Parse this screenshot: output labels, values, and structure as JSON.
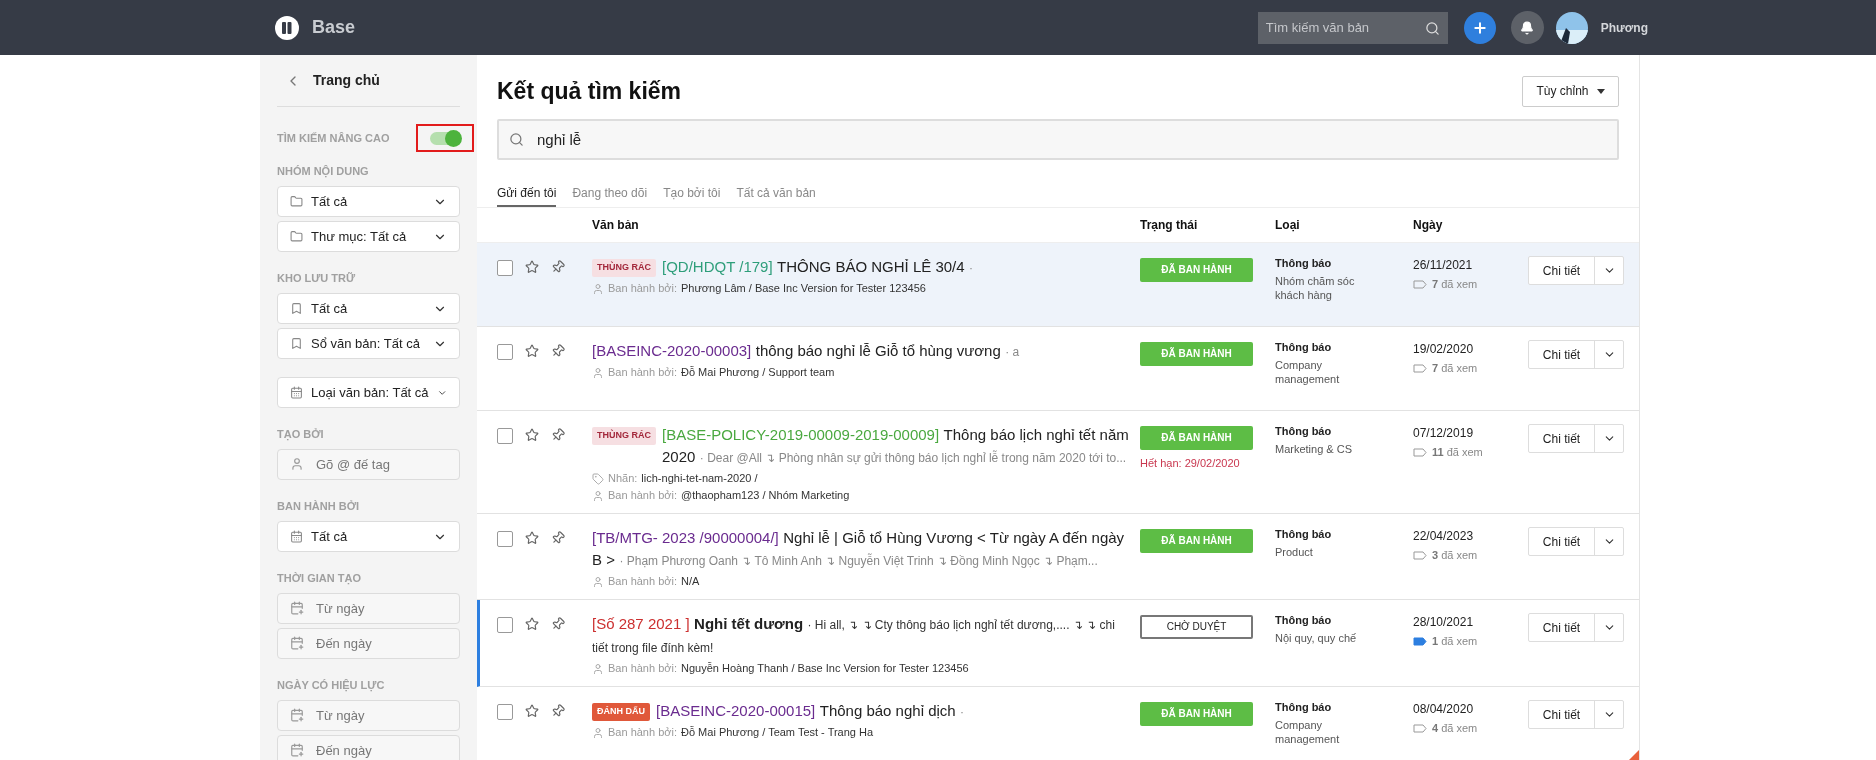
{
  "topbar": {
    "brand": "Base",
    "search": {
      "placeholder": "Tìm kiếm văn bản"
    },
    "user": "Phương"
  },
  "sidebar": {
    "back": "Trang chủ",
    "advanced": {
      "label": "TÌM KIẾM NÂNG CAO",
      "on": true
    },
    "sections": [
      {
        "label": "NHÓM NỘI DUNG",
        "fields": [
          {
            "kind": "select",
            "text": "Tất cả"
          },
          {
            "kind": "select",
            "text": "Thư mục: Tất cả"
          }
        ]
      },
      {
        "label": "KHO LƯU TRỮ",
        "fields": [
          {
            "kind": "select",
            "text": "Tất cả"
          },
          {
            "kind": "select",
            "text": "Sổ văn bản: Tất cả"
          }
        ]
      },
      {
        "fields": [
          {
            "kind": "select",
            "text": "Loại văn bản: Tất cả"
          }
        ]
      },
      {
        "label": "TẠO BỞI",
        "fields": [
          {
            "kind": "input",
            "placeholder": "Gõ @ đế tag"
          }
        ]
      },
      {
        "label": "BAN HÀNH BỞI",
        "fields": [
          {
            "kind": "select",
            "text": "Tất cả"
          }
        ]
      },
      {
        "label": "THỜI GIAN TẠO",
        "fields": [
          {
            "kind": "date",
            "placeholder": "Từ ngày"
          },
          {
            "kind": "date",
            "placeholder": "Đến ngày"
          }
        ]
      },
      {
        "label": "NGÀY CÓ HIỆU LỰC",
        "fields": [
          {
            "kind": "date",
            "placeholder": "Từ ngày"
          },
          {
            "kind": "date",
            "placeholder": "Đến ngày"
          }
        ]
      }
    ]
  },
  "main": {
    "title": "Kết quả tìm kiếm",
    "customize": "Tùy chỉnh",
    "query": "nghỉ lễ",
    "tabs": [
      {
        "label": "Gửi đến tôi",
        "selected": true
      },
      {
        "label": "Đang theo dõi",
        "selected": false
      },
      {
        "label": "Tạo bởi tôi",
        "selected": false
      },
      {
        "label": "Tất cả văn bản",
        "selected": false
      }
    ],
    "columns": [
      "Văn bản",
      "Trạng thái",
      "Loại",
      "Ngày"
    ],
    "rows": [
      {
        "selected": true,
        "unread": false,
        "tag": {
          "kind": "trash",
          "label": "THÙNG RÁC"
        },
        "code": "[QD/HDQT /179]",
        "color": "#2e9e7a",
        "title": "THÔNG BÁO NGHỈ LÊ 30/4",
        "excerpt": "·",
        "issuer_label": "Ban hành bởi:",
        "issuer": "Phương Lâm / Base Inc Version for Tester 123456",
        "status": {
          "kind": "published",
          "label": "ĐÃ BAN HÀNH"
        },
        "type": "Thông báo",
        "group": "Nhóm chăm sóc khách hàng",
        "date": "26/11/2021",
        "views": "7",
        "views_label": "đã xem",
        "action": "Chi tiết"
      },
      {
        "selected": false,
        "unread": false,
        "code": "[BASEINC-2020-00003]",
        "color": "#6a2b8f",
        "title": "thông báo nghỉ lễ Giỗ tổ hùng vương",
        "excerpt": "· a",
        "issuer_label": "Ban hành bởi:",
        "issuer": "Đỗ Mai Phương / Support team",
        "status": {
          "kind": "published",
          "label": "ĐÃ BAN HÀNH"
        },
        "type": "Thông báo",
        "group": "Company management",
        "date": "19/02/2020",
        "views": "7",
        "views_label": "đã xem",
        "action": "Chi tiết"
      },
      {
        "selected": false,
        "unread": false,
        "tag": {
          "kind": "trash",
          "label": "THÙNG RÁC"
        },
        "code": "[BASE-POLICY-2019-00009-2019-00009]",
        "color": "#4aa83f",
        "title": "Thông báo lịch nghỉ tết năm 2020",
        "excerpt": "· Dear @All ↴ Phòng nhân sự gửi thông báo lịch nghỉ lễ trong năm 2020 tới to...",
        "label_label": "Nhãn:",
        "label": "lich-nghi-tet-nam-2020 /",
        "issuer_label": "Ban hành bởi:",
        "issuer": "@thaopham123 / Nhóm Marketing",
        "status": {
          "kind": "published",
          "label": "ĐÃ BAN HÀNH"
        },
        "expiry": "Hết hạn: 29/02/2020",
        "type": "Thông báo",
        "group": "Marketing & CS",
        "date": "07/12/2019",
        "views": "11",
        "views_label": "đã xem",
        "action": "Chi tiết"
      },
      {
        "selected": false,
        "unread": false,
        "code": "[TB/MTG- 2023 /90000004/]",
        "color": "#6a2b8f",
        "title": "Nghỉ lễ | Giỗ tổ Hùng Vương < Từ ngày A đến ngày B >",
        "excerpt": "· Phạm Phương Oanh ↴ Tô Minh Anh ↴ Nguyễn Việt Trinh ↴ Đồng Minh Ngọc ↴ Phạm...",
        "issuer_label": "Ban hành bởi:",
        "issuer": "N/A",
        "status": {
          "kind": "published",
          "label": "ĐÃ BAN HÀNH"
        },
        "type": "Thông báo",
        "group": "Product",
        "date": "22/04/2023",
        "views": "3",
        "views_label": "đã xem",
        "action": "Chi tiết"
      },
      {
        "selected": false,
        "unread": true,
        "code": "[Số 287 2021 ]",
        "color": "#cc2f2f",
        "title": "Nghỉ tết dương",
        "excerpt": "· Hi all, ↴ ↴ Cty thông báo lịch nghỉ tết dương,.... ↴ ↴ chi tiết trong file đính kèm!",
        "issuer_label": "Ban hành bởi:",
        "issuer": "Nguyễn Hoàng Thanh / Base Inc Version for Tester 123456",
        "status": {
          "kind": "pending",
          "label": "CHỜ DUYỆT"
        },
        "type": "Thông báo",
        "group": "Nội quy, quy chế",
        "date": "28/10/2021",
        "views": "1",
        "views_label": "đã xem",
        "action": "Chi tiết"
      },
      {
        "selected": false,
        "unread": false,
        "tag": {
          "kind": "flag",
          "label": "ĐÁNH DẤU"
        },
        "code": "[BASEINC-2020-00015]",
        "color": "#6a2b8f",
        "title": "Thông báo nghỉ dịch",
        "excerpt": "·",
        "issuer_label": "Ban hành bởi:",
        "issuer": "Đỗ Mai Phương / Team Test - Trang Ha",
        "status": {
          "kind": "published",
          "label": "ĐÃ BAN HÀNH"
        },
        "type": "Thông báo",
        "group": "Company management",
        "date": "08/04/2020",
        "views": "4",
        "views_label": "đã xem",
        "action": "Chi tiết"
      }
    ]
  }
}
